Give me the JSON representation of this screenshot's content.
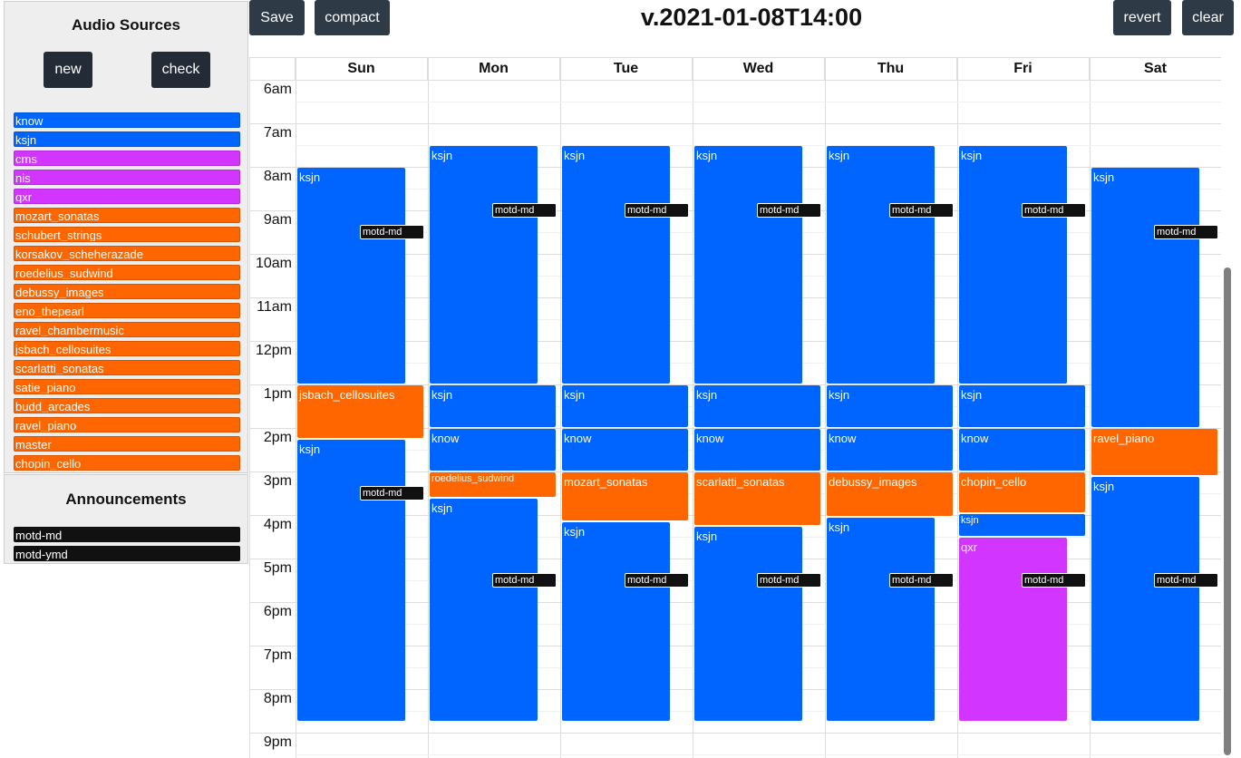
{
  "toolbar": {
    "save_label": "Save",
    "compact_label": "compact",
    "revert_label": "revert",
    "clear_label": "clear"
  },
  "version_title": "v.2021-01-08T14:00",
  "sidebar": {
    "sources_title": "Audio Sources",
    "new_label": "new",
    "check_label": "check",
    "sources": [
      {
        "label": "know",
        "color": "#0064ff"
      },
      {
        "label": "ksjn",
        "color": "#0064ff"
      },
      {
        "label": "cms",
        "color": "#d235ff"
      },
      {
        "label": "nis",
        "color": "#d235ff"
      },
      {
        "label": "qxr",
        "color": "#d235ff"
      },
      {
        "label": "mozart_sonatas",
        "color": "#ff6600"
      },
      {
        "label": "schubert_strings",
        "color": "#ff6600"
      },
      {
        "label": "korsakov_scheherazade",
        "color": "#ff6600"
      },
      {
        "label": "roedelius_sudwind",
        "color": "#ff6600"
      },
      {
        "label": "debussy_images",
        "color": "#ff6600"
      },
      {
        "label": "eno_thepearl",
        "color": "#ff6600"
      },
      {
        "label": "ravel_chambermusic",
        "color": "#ff6600"
      },
      {
        "label": "jsbach_cellosuites",
        "color": "#ff6600"
      },
      {
        "label": "scarlatti_sonatas",
        "color": "#ff6600"
      },
      {
        "label": "satie_piano",
        "color": "#ff6600"
      },
      {
        "label": "budd_arcades",
        "color": "#ff6600"
      },
      {
        "label": "ravel_piano",
        "color": "#ff6600"
      },
      {
        "label": "master",
        "color": "#ff6600"
      },
      {
        "label": "chopin_cello",
        "color": "#ff6600"
      }
    ],
    "announcements_title": "Announcements",
    "announcements": [
      {
        "label": "motd-md",
        "color": "#111111"
      },
      {
        "label": "motd-ymd",
        "color": "#111111"
      }
    ]
  },
  "colors": {
    "blue": "#0064ff",
    "purple": "#d235ff",
    "orange": "#ff6600",
    "black": "#111111"
  },
  "calendar": {
    "days": [
      "Sun",
      "Mon",
      "Tue",
      "Wed",
      "Thu",
      "Fri",
      "Sat"
    ],
    "hours": [
      "6am",
      "7am",
      "8am",
      "9am",
      "10am",
      "11am",
      "12pm",
      "1pm",
      "2pm",
      "3pm",
      "4pm",
      "5pm",
      "6pm",
      "7pm",
      "8pm",
      "9pm"
    ],
    "events": [
      {
        "day": 0,
        "start": 8.0,
        "end": 13.0,
        "label": "ksjn",
        "color": "blue",
        "narrow": true
      },
      {
        "day": 0,
        "start": 13.0,
        "end": 14.25,
        "label": "jsbach_cellosuites",
        "color": "orange"
      },
      {
        "day": 0,
        "start": 14.25,
        "end": 20.75,
        "label": "ksjn",
        "color": "blue",
        "narrow": true
      },
      {
        "day": 1,
        "start": 7.5,
        "end": 13.0,
        "label": "ksjn",
        "color": "blue",
        "narrow": true
      },
      {
        "day": 1,
        "start": 13.0,
        "end": 14.0,
        "label": "ksjn",
        "color": "blue"
      },
      {
        "day": 1,
        "start": 14.0,
        "end": 15.0,
        "label": "know",
        "color": "blue"
      },
      {
        "day": 1,
        "start": 15.0,
        "end": 15.6,
        "label": "roedelius_sudwind",
        "color": "orange",
        "small": true
      },
      {
        "day": 1,
        "start": 15.6,
        "end": 20.75,
        "label": "ksjn",
        "color": "blue",
        "narrow": true
      },
      {
        "day": 2,
        "start": 7.5,
        "end": 13.0,
        "label": "ksjn",
        "color": "blue",
        "narrow": true
      },
      {
        "day": 2,
        "start": 13.0,
        "end": 14.0,
        "label": "ksjn",
        "color": "blue"
      },
      {
        "day": 2,
        "start": 14.0,
        "end": 15.0,
        "label": "know",
        "color": "blue"
      },
      {
        "day": 2,
        "start": 15.0,
        "end": 16.15,
        "label": "mozart_sonatas",
        "color": "orange"
      },
      {
        "day": 2,
        "start": 16.15,
        "end": 20.75,
        "label": "ksjn",
        "color": "blue",
        "narrow": true
      },
      {
        "day": 3,
        "start": 7.5,
        "end": 13.0,
        "label": "ksjn",
        "color": "blue",
        "narrow": true
      },
      {
        "day": 3,
        "start": 13.0,
        "end": 14.0,
        "label": "ksjn",
        "color": "blue"
      },
      {
        "day": 3,
        "start": 14.0,
        "end": 15.0,
        "label": "know",
        "color": "blue"
      },
      {
        "day": 3,
        "start": 15.0,
        "end": 16.25,
        "label": "scarlatti_sonatas",
        "color": "orange"
      },
      {
        "day": 3,
        "start": 16.25,
        "end": 20.75,
        "label": "ksjn",
        "color": "blue",
        "narrow": true
      },
      {
        "day": 4,
        "start": 7.5,
        "end": 13.0,
        "label": "ksjn",
        "color": "blue",
        "narrow": true
      },
      {
        "day": 4,
        "start": 13.0,
        "end": 14.0,
        "label": "ksjn",
        "color": "blue"
      },
      {
        "day": 4,
        "start": 14.0,
        "end": 15.0,
        "label": "know",
        "color": "blue"
      },
      {
        "day": 4,
        "start": 15.0,
        "end": 16.05,
        "label": "debussy_images",
        "color": "orange"
      },
      {
        "day": 4,
        "start": 16.05,
        "end": 20.75,
        "label": "ksjn",
        "color": "blue",
        "narrow": true
      },
      {
        "day": 5,
        "start": 7.5,
        "end": 13.0,
        "label": "ksjn",
        "color": "blue",
        "narrow": true
      },
      {
        "day": 5,
        "start": 13.0,
        "end": 14.0,
        "label": "ksjn",
        "color": "blue"
      },
      {
        "day": 5,
        "start": 14.0,
        "end": 15.0,
        "label": "know",
        "color": "blue"
      },
      {
        "day": 5,
        "start": 15.0,
        "end": 15.95,
        "label": "chopin_cello",
        "color": "orange"
      },
      {
        "day": 5,
        "start": 15.95,
        "end": 16.5,
        "label": "ksjn",
        "color": "blue",
        "small": true
      },
      {
        "day": 5,
        "start": 16.5,
        "end": 20.75,
        "label": "qxr",
        "color": "purple",
        "narrow": true
      },
      {
        "day": 6,
        "start": 8.0,
        "end": 14.0,
        "label": "ksjn",
        "color": "blue",
        "narrow": true
      },
      {
        "day": 6,
        "start": 14.0,
        "end": 15.1,
        "label": "ravel_piano",
        "color": "orange"
      },
      {
        "day": 6,
        "start": 15.1,
        "end": 20.75,
        "label": "ksjn",
        "color": "blue",
        "narrow": true
      }
    ],
    "announcements": [
      {
        "day": 0,
        "time": 9.5,
        "label": "motd-md"
      },
      {
        "day": 0,
        "time": 15.5,
        "label": "motd-md"
      },
      {
        "day": 1,
        "time": 9.0,
        "label": "motd-md"
      },
      {
        "day": 1,
        "time": 17.5,
        "label": "motd-md"
      },
      {
        "day": 2,
        "time": 9.0,
        "label": "motd-md"
      },
      {
        "day": 2,
        "time": 17.5,
        "label": "motd-md"
      },
      {
        "day": 3,
        "time": 9.0,
        "label": "motd-md"
      },
      {
        "day": 3,
        "time": 17.5,
        "label": "motd-md"
      },
      {
        "day": 4,
        "time": 9.0,
        "label": "motd-md"
      },
      {
        "day": 4,
        "time": 17.5,
        "label": "motd-md"
      },
      {
        "day": 5,
        "time": 9.0,
        "label": "motd-md"
      },
      {
        "day": 5,
        "time": 17.5,
        "label": "motd-md"
      },
      {
        "day": 6,
        "time": 9.5,
        "label": "motd-md"
      },
      {
        "day": 6,
        "time": 17.5,
        "label": "motd-md"
      }
    ]
  }
}
